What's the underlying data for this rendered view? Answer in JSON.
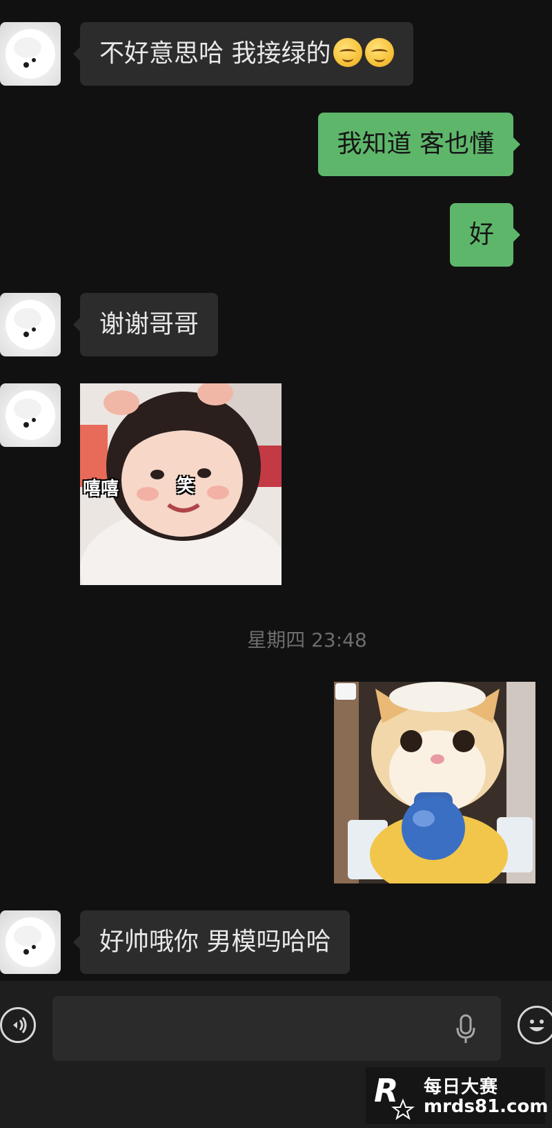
{
  "conversation": {
    "messages": [
      {
        "side": "left",
        "type": "text",
        "text": "不好意思哈 我接绿的",
        "emoji": [
          "smiling-face-icon",
          "smiling-face-icon"
        ]
      },
      {
        "side": "right",
        "type": "text",
        "text": "我知道 客也懂"
      },
      {
        "side": "right",
        "type": "text",
        "text": "好"
      },
      {
        "side": "left",
        "type": "text",
        "text": "谢谢哥哥"
      },
      {
        "side": "left",
        "type": "sticker",
        "subject": "baby-sticker",
        "caption_left": "嘻嘻",
        "caption_right": "笑"
      },
      {
        "side": "right",
        "type": "sticker",
        "subject": "cat-with-water-gun-sticker"
      },
      {
        "side": "left",
        "type": "text",
        "text": "好帅哦你 男模吗哈哈"
      }
    ],
    "timestamp": "星期四 23:48"
  },
  "colors": {
    "background": "#111111",
    "bubble_left": "#2c2c2c",
    "bubble_right": "#5eb66b",
    "timestamp": "#6d6d6d"
  },
  "input_bar": {
    "voice_icon": "voice-icon",
    "mic_icon": "microphone-icon",
    "emoji_icon": "emoji-icon",
    "value": ""
  },
  "watermark": {
    "line1": "每日大赛",
    "line2": "mrds81.com",
    "logo_icon": "r-star-logo-icon"
  }
}
